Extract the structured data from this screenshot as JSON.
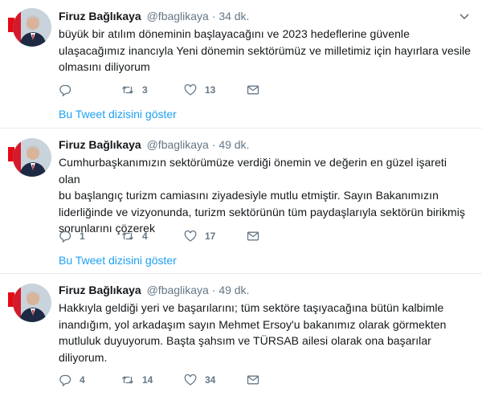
{
  "tweets": [
    {
      "name": "Firuz Bağlıkaya",
      "handle": "@fbaglikaya",
      "dot": "·",
      "time": "34 dk.",
      "lines": [
        "büyük bir atılım döneminin başlayacağını ve 2023 hedeflerine  güvenle",
        "ulaşacağımız inancıyla Yeni dönemin sektörümüz ve milletimiz için hayırlara vesile",
        "olmasını diliyorum"
      ],
      "reply_count": "",
      "retweet_count": "3",
      "like_count": "13",
      "thread_link": "Bu Tweet dizisini göster"
    },
    {
      "name": "Firuz Bağlıkaya",
      "handle": "@fbaglikaya",
      "dot": "·",
      "time": "49 dk.",
      "lines": [
        "Cumhurbaşkanımızın sektörümüze verdiği önemin ve değerin en güzel işareti olan",
        "bu başlangıç turizm camiasını ziyadesiyle mutlu etmiştir. Sayın Bakanımızın",
        "liderliğinde ve vizyonunda, turizm sektörünün tüm paydaşlarıyla sektörün birikmiş",
        "sorunlarını çözerek"
      ],
      "reply_count": "1",
      "retweet_count": "4",
      "like_count": "17",
      "thread_link": "Bu Tweet dizisini göster"
    },
    {
      "name": "Firuz Bağlıkaya",
      "handle": "@fbaglikaya",
      "dot": "·",
      "time": "49 dk.",
      "lines": [
        "Hakkıyla geldiği yeri ve başarılarını; tüm sektöre taşıyacağına bütün kalbimle",
        "inandığım, yol arkadaşım sayın Mehmet Ersoy'u bakanımız olarak görmekten",
        "mutluluk duyuyorum. Başta şahsım ve TÜRSAB ailesi olarak ona başarılar",
        "diliyorum."
      ],
      "reply_count": "4",
      "retweet_count": "14",
      "like_count": "34",
      "thread_link": ""
    }
  ],
  "icons": [
    "avatar",
    "reply-icon",
    "retweet-icon",
    "like-icon",
    "message-icon",
    "chevron-down-icon"
  ],
  "colors": {
    "link": "#1da1f2",
    "muted": "#657786",
    "text": "#14171a",
    "divider": "#e6ecf0",
    "flag": "#e30a17"
  }
}
